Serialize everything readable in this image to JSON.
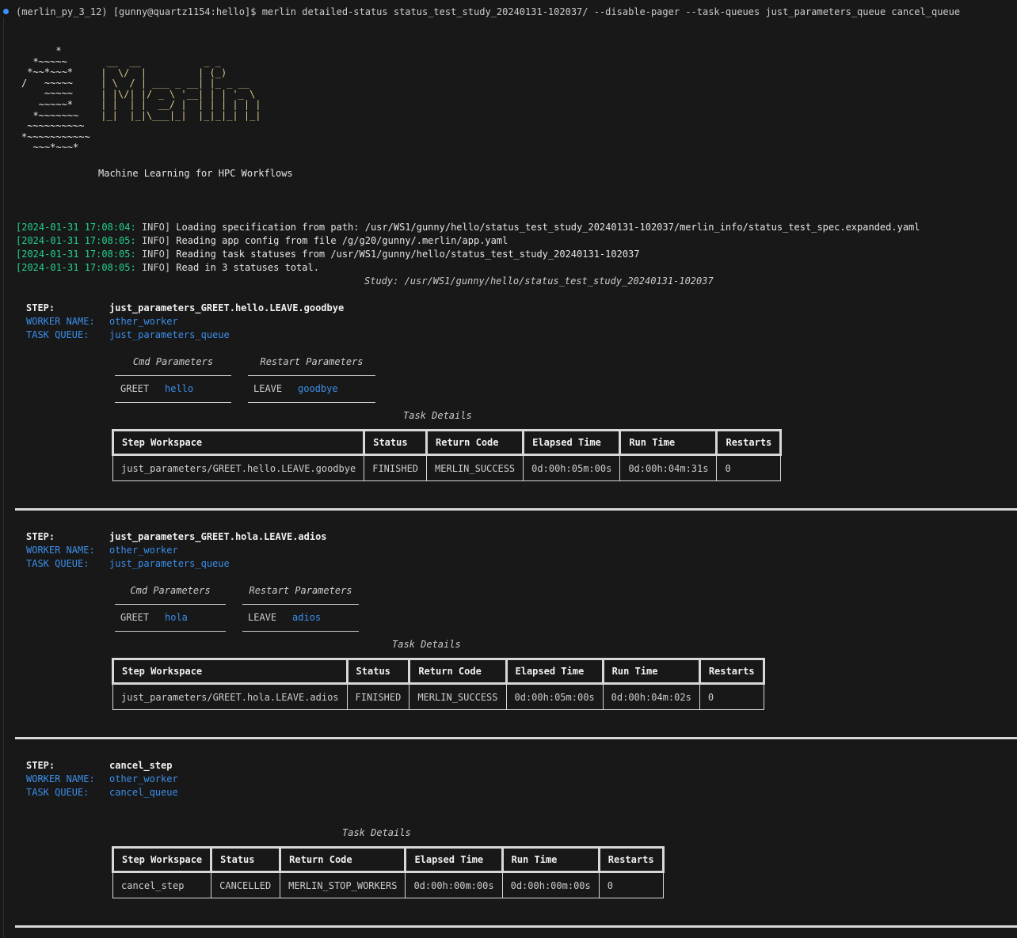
{
  "command_line": {
    "env": "(merlin_py_3_12)",
    "host": "[gunny@quartz1154:hello]$",
    "command": "merlin detailed-status status_test_study_20240131-102037/ --disable-pager --task-queues just_parameters_queue cancel_queue"
  },
  "banner": {
    "logo_lines": [
      "      *",
      "  *~~~~~",
      " *~~*~~~*",
      "/   ~~~~~",
      "    ~~~~~",
      "   ~~~~~*",
      "  *~~~~~~~",
      " ~~~~~~~~~~",
      "*~~~~~~~~~~~",
      "  ~~~*~~~*"
    ],
    "art_lines": [
      "",
      "",
      "  __  __           _ _",
      " |  \\/  |         | (_)",
      " | \\  / | ___ _ __| |_ _ __",
      " | |\\/| |/ _ \\ '__| | | '_ \\",
      " | |  | |  __/ |  | | | | | |",
      " |_|  |_|\\___|_|  |_|_|_| |_|",
      "",
      ""
    ],
    "tagline": "Machine Learning for HPC Workflows"
  },
  "logs": [
    {
      "ts": "[2024-01-31 17:08:04:",
      "level": "INFO]",
      "msg": "Loading specification from path: /usr/WS1/gunny/hello/status_test_study_20240131-102037/merlin_info/status_test_spec.expanded.yaml"
    },
    {
      "ts": "[2024-01-31 17:08:05:",
      "level": "INFO]",
      "msg": "Reading app config from file /g/g20/gunny/.merlin/app.yaml"
    },
    {
      "ts": "[2024-01-31 17:08:05:",
      "level": "INFO]",
      "msg": "Reading task statuses from /usr/WS1/gunny/hello/status_test_study_20240131-102037"
    },
    {
      "ts": "[2024-01-31 17:08:05:",
      "level": "INFO]",
      "msg": "Read in 3 statuses total."
    }
  ],
  "study_line": "Study: /usr/WS1/gunny/hello/status_test_study_20240131-102037",
  "labels": {
    "step": "STEP:",
    "worker_name": "WORKER NAME:",
    "task_queue": "TASK QUEUE:",
    "cmd_params": "Cmd Parameters",
    "restart_params": "Restart Parameters",
    "task_details": "Task Details",
    "headers": [
      "Step Workspace",
      "Status",
      "Return Code",
      "Elapsed Time",
      "Run Time",
      "Restarts"
    ]
  },
  "steps": [
    {
      "step": "just_parameters_GREET.hello.LEAVE.goodbye",
      "worker": "other_worker",
      "queue": "just_parameters_queue",
      "cmd_key": "GREET",
      "cmd_val": "hello",
      "restart_key": "LEAVE",
      "restart_val": "goodbye",
      "row": [
        "just_parameters/GREET.hello.LEAVE.goodbye",
        "FINISHED",
        "MERLIN_SUCCESS",
        "0d:00h:05m:00s",
        "0d:00h:04m:31s",
        "0"
      ]
    },
    {
      "step": "just_parameters_GREET.hola.LEAVE.adios",
      "worker": "other_worker",
      "queue": "just_parameters_queue",
      "cmd_key": "GREET",
      "cmd_val": "hola",
      "restart_key": "LEAVE",
      "restart_val": "adios",
      "row": [
        "just_parameters/GREET.hola.LEAVE.adios",
        "FINISHED",
        "MERLIN_SUCCESS",
        "0d:00h:05m:00s",
        "0d:00h:04m:02s",
        "0"
      ]
    },
    {
      "step": "cancel_step",
      "worker": "other_worker",
      "queue": "cancel_queue",
      "row": [
        "cancel_step",
        "CANCELLED",
        "MERLIN_STOP_WORKERS",
        "0d:00h:00m:00s",
        "0d:00h:00m:00s",
        "0"
      ]
    }
  ],
  "colors": {
    "background": "#181818",
    "finished": "#23d18b",
    "cancelled": "#e5e510",
    "info_blue": "#3b8eea",
    "log_green": "#23d18b"
  }
}
